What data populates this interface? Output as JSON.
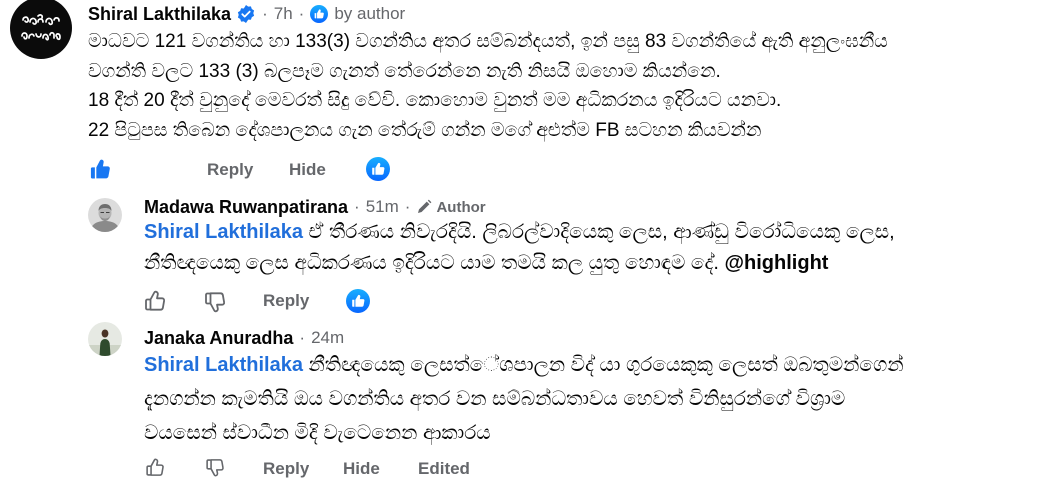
{
  "colors": {
    "text": "#050505",
    "meta": "#65676b",
    "link": "#216fdb",
    "brand_blue": "#1877f2"
  },
  "icons": {
    "verified": "verified-badge-icon",
    "liked_by": "like-reaction-icon",
    "like_active": "thumbs-up-filled-icon",
    "like": "thumbs-up-icon",
    "dislike": "thumbs-down-icon",
    "reaction": "like-reaction-icon",
    "author_badge": "pencil-icon"
  },
  "separator": "·",
  "comment": {
    "author": "Shiral Lakthilaka",
    "verified": true,
    "time": "7h",
    "liked_by": "by author",
    "lines": [
      "මාධවට 121 වගන්තිය හා 133(3) වගන්තිය අතර සම්බන්දයත්, ඉන් පසු 83 වගන්තියේ ඇති අනුලංඝනීය",
      "වගන්ති වලට 133 (3) බලපෑම ගැනත් තේරෙන්නෙ නැති නිසයි ඔහොම කියන්නෙ.",
      "18 දීත් 20 දීත් වුනුදේ මෙවරත් සිදු වේවි. කොහොම වුනත් මම අධිකරනය ඉදිරියට යනවා.",
      "22 පිටුපස තිබෙන දේශපාලනය ගැන තේරුම් ගන්න මගේ අළුත්ම FB සටහන කියවන්න"
    ],
    "liked": true,
    "actions": {
      "reply": "Reply",
      "hide": "Hide"
    }
  },
  "replies": [
    {
      "author": "Madawa Ruwanpatirana",
      "time": "51m",
      "badge": "Author",
      "mention": "Shiral Lakthilaka",
      "lines": [
        "ඒ තීරණය නිවැරදියි. ලිබරල්වාදියෙකු ලෙස, ආණ්ඩු විරෝධියෙකු ලෙස,",
        "නීතිඥයෙකු ලෙස අධිකරණය ඉදිරියට යාම තමයි කල යුතු හොඳම දේ."
      ],
      "tag": "@highlight",
      "actions": {
        "reply": "Reply"
      }
    },
    {
      "author": "Janaka Anuradha",
      "time": "24m",
      "mention": "Shiral Lakthilaka",
      "lines": [
        "නීතිඥයෙකු ලෙසත්ේශපාලන විද් යා ගුරයෙකුකු ලෙසත් ඔබතුමන්ගෙන්",
        "දැනගන්න කැමතියි ඔය වගන්තිය අතර වන සම්බන්ධතාවය හෙවත් විනිසුරන්ගේ විශ්‍රාම",
        "වයසෙන් ස්වාධීන මිදි වැටෙනෙන ආකාරය"
      ],
      "actions": {
        "reply": "Reply",
        "hide": "Hide",
        "edited": "Edited"
      }
    }
  ]
}
